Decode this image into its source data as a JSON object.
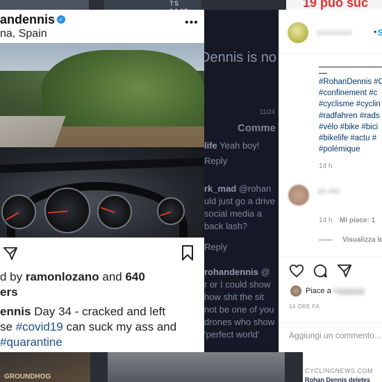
{
  "background": {
    "top_plate_text": "TS 1149",
    "top_right_headline": "19 può suc",
    "bottom_left_text": "GROUNDHOG",
    "bottom_right_source": "CYCLINGNEWS.COM",
    "bottom_right_headline": "Rohan Dennis deletes"
  },
  "screenshot": {
    "username": "andennis",
    "location": "na, Spain",
    "more_icon": "more-horizontal-icon",
    "liked_by_prefix": "d by ",
    "liked_by_user": "ramonlozano",
    "liked_by_mid": " and ",
    "liked_by_count": "640",
    "liked_by_suffix": "ers",
    "caption_user": "ennis",
    "caption_line1_rest": " Day 34 - cracked and left",
    "caption_line2_start": "se ",
    "caption_tag1": "#covid19",
    "caption_line2_rest": " can suck my ass and",
    "caption_tag2": "#quarantine"
  },
  "overlay": {
    "big_text": "Dennis is no",
    "date": "11/24",
    "comments_header": "Comme",
    "lines": [
      {
        "user": "life",
        "text": " Yeah boy!"
      },
      {
        "user": "",
        "text": " Reply"
      },
      {
        "user": "rk_mad",
        "text": " @rohan"
      },
      {
        "user": "",
        "text": "uld just go a drive"
      },
      {
        "user": "",
        "text": " social media a"
      },
      {
        "user": "",
        "text": " back lash?"
      },
      {
        "user": "",
        "text": " Reply"
      },
      {
        "user": "rohandennis",
        "text": " @"
      },
      {
        "user": "",
        "text": "r or I could show"
      },
      {
        "user": "",
        "text": " how shit the sit"
      },
      {
        "user": "",
        "text": " not be one of you"
      },
      {
        "user": "",
        "text": " drones who show"
      },
      {
        "user": "",
        "text": " 'perfect world'"
      }
    ]
  },
  "instagram": {
    "username_blurred": "iiiiiiiiiiiiiiiiiii",
    "follow_dot": "•",
    "follow_label": "S",
    "separator": "————————\n—",
    "hashtags": [
      "#RohanDennis #C",
      "#confinement #c",
      "#cyclisme #cyclin",
      "#radfahren #rads",
      "#vélo #bike #bici",
      "#bikelife #actu #",
      "#polémique"
    ],
    "time_post": "14 h",
    "comment_blurred": "iiiii iiiiiii",
    "time_comment": "14 h",
    "comment_likes": "Mi piace: 1",
    "view_replies": "Visualizza le",
    "liked_prefix": "Piace a ",
    "liked_blurred": "lajjjjjjjjjjjjjjj",
    "post_date": "14 ORE FA",
    "comment_placeholder": "Aggiungi un commento..."
  }
}
